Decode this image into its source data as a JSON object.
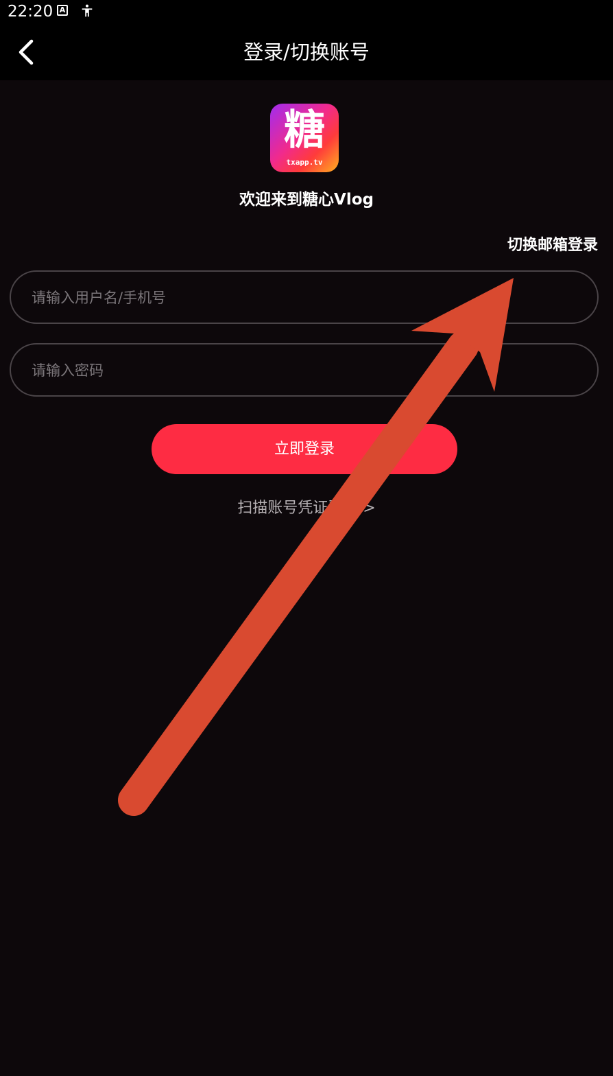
{
  "status_bar": {
    "time": "22:20",
    "icons": [
      "a-notification-icon",
      "accessibility-icon"
    ]
  },
  "header": {
    "back_icon": "chevron-left-icon",
    "title": "登录/切换账号"
  },
  "logo": {
    "char": "糖",
    "subtitle": "txapp.tv"
  },
  "welcome": "欢迎来到糖心Vlog",
  "switch_email_label": "切换邮箱登录",
  "form": {
    "username_placeholder": "请输入用户名/手机号",
    "username_value": "",
    "password_placeholder": "请输入密码",
    "password_value": ""
  },
  "login_button": "立即登录",
  "scan_link": "扫描账号凭证登录 >",
  "colors": {
    "background": "#0d080b",
    "header": "#000000",
    "accent": "#fe2c43",
    "annotation_arrow": "#d94a30"
  }
}
